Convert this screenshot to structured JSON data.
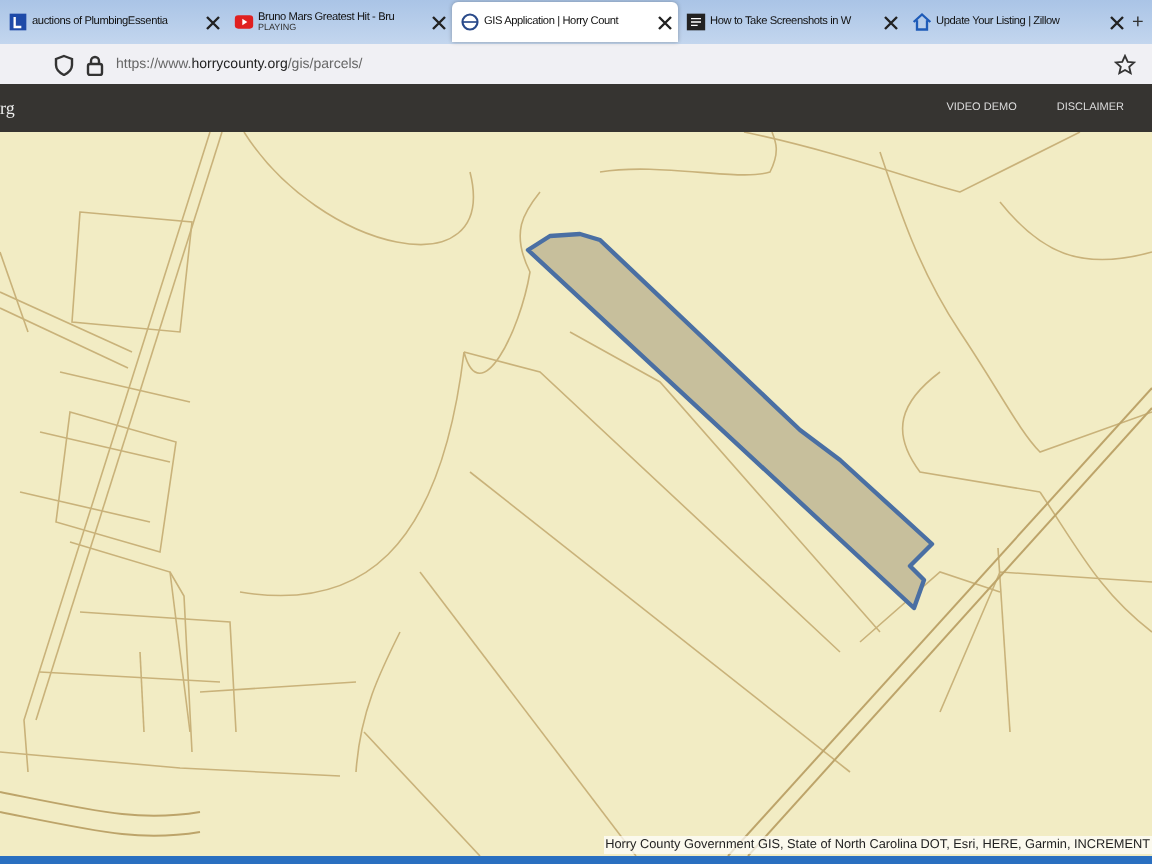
{
  "tabs": [
    {
      "title": "auctions of PlumbingEssentia",
      "selected": false
    },
    {
      "title": "Bruno Mars Greatest Hit - Bru",
      "subtitle": "PLAYING",
      "selected": false
    },
    {
      "title": "GIS Application | Horry Count",
      "selected": true
    },
    {
      "title": "How to Take Screenshots in W",
      "selected": false
    },
    {
      "title": "Update Your Listing | Zillow",
      "selected": false
    }
  ],
  "new_tab": "+",
  "address": {
    "host_prefix": "https://www.",
    "host": "horrycounty.org",
    "path": "/gis/parcels/"
  },
  "site_header": {
    "logo_fragment": "rg",
    "links": [
      "VIDEO DEMO",
      "DISCLAIMER"
    ]
  },
  "map": {
    "attribution": "Horry County Government GIS, State of North Carolina DOT, Esri, HERE, Garmin, INCREMENT"
  }
}
